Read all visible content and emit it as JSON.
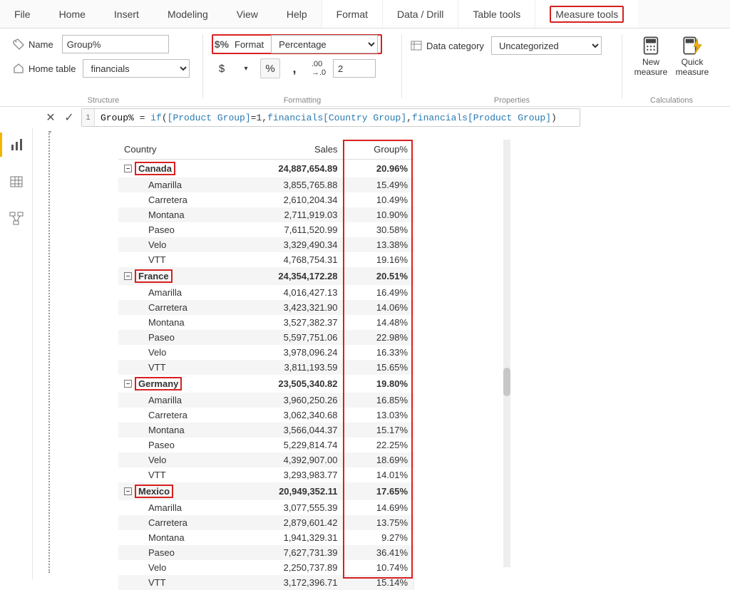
{
  "ribbon": {
    "tabs": [
      "File",
      "Home",
      "Insert",
      "Modeling",
      "View",
      "Help",
      "Format",
      "Data / Drill",
      "Table tools",
      "Measure tools"
    ],
    "active_tab": 9
  },
  "structure": {
    "name_label": "Name",
    "name_value": "Group%",
    "home_table_label": "Home table",
    "home_table_value": "financials",
    "group_label": "Structure"
  },
  "formatting": {
    "format_label": "Format",
    "format_value": "Percentage",
    "decimals_value": "2",
    "group_label": "Formatting"
  },
  "properties": {
    "data_category_label": "Data category",
    "data_category_value": "Uncategorized",
    "group_label": "Properties"
  },
  "calculations": {
    "new_measure_label": "New measure",
    "quick_measure_label": "Quick measure",
    "group_label": "Calculations"
  },
  "formula": {
    "line_no": "1",
    "measure_name": "Group%",
    "text_after": " = if([Product Group]=1,financials[Country Group],financials[Product Group])"
  },
  "table": {
    "headers": [
      "Country",
      "Sales",
      "Group%"
    ],
    "countries": [
      {
        "name": "Canada",
        "sales": "24,887,654.89",
        "pct": "20.96%",
        "rows": [
          {
            "p": "Amarilla",
            "s": "3,855,765.88",
            "g": "15.49%"
          },
          {
            "p": "Carretera",
            "s": "2,610,204.34",
            "g": "10.49%"
          },
          {
            "p": "Montana",
            "s": "2,711,919.03",
            "g": "10.90%"
          },
          {
            "p": "Paseo",
            "s": "7,611,520.99",
            "g": "30.58%"
          },
          {
            "p": "Velo",
            "s": "3,329,490.34",
            "g": "13.38%"
          },
          {
            "p": "VTT",
            "s": "4,768,754.31",
            "g": "19.16%"
          }
        ]
      },
      {
        "name": "France",
        "sales": "24,354,172.28",
        "pct": "20.51%",
        "rows": [
          {
            "p": "Amarilla",
            "s": "4,016,427.13",
            "g": "16.49%"
          },
          {
            "p": "Carretera",
            "s": "3,423,321.90",
            "g": "14.06%"
          },
          {
            "p": "Montana",
            "s": "3,527,382.37",
            "g": "14.48%"
          },
          {
            "p": "Paseo",
            "s": "5,597,751.06",
            "g": "22.98%"
          },
          {
            "p": "Velo",
            "s": "3,978,096.24",
            "g": "16.33%"
          },
          {
            "p": "VTT",
            "s": "3,811,193.59",
            "g": "15.65%"
          }
        ]
      },
      {
        "name": "Germany",
        "sales": "23,505,340.82",
        "pct": "19.80%",
        "rows": [
          {
            "p": "Amarilla",
            "s": "3,960,250.26",
            "g": "16.85%"
          },
          {
            "p": "Carretera",
            "s": "3,062,340.68",
            "g": "13.03%"
          },
          {
            "p": "Montana",
            "s": "3,566,044.37",
            "g": "15.17%"
          },
          {
            "p": "Paseo",
            "s": "5,229,814.74",
            "g": "22.25%"
          },
          {
            "p": "Velo",
            "s": "4,392,907.00",
            "g": "18.69%"
          },
          {
            "p": "VTT",
            "s": "3,293,983.77",
            "g": "14.01%"
          }
        ]
      },
      {
        "name": "Mexico",
        "sales": "20,949,352.11",
        "pct": "17.65%",
        "rows": [
          {
            "p": "Amarilla",
            "s": "3,077,555.39",
            "g": "14.69%"
          },
          {
            "p": "Carretera",
            "s": "2,879,601.42",
            "g": "13.75%"
          },
          {
            "p": "Montana",
            "s": "1,941,329.31",
            "g": "9.27%"
          },
          {
            "p": "Paseo",
            "s": "7,627,731.39",
            "g": "36.41%"
          },
          {
            "p": "Velo",
            "s": "2,250,737.89",
            "g": "10.74%"
          },
          {
            "p": "VTT",
            "s": "3,172,396.71",
            "g": "15.14%"
          }
        ]
      }
    ]
  }
}
